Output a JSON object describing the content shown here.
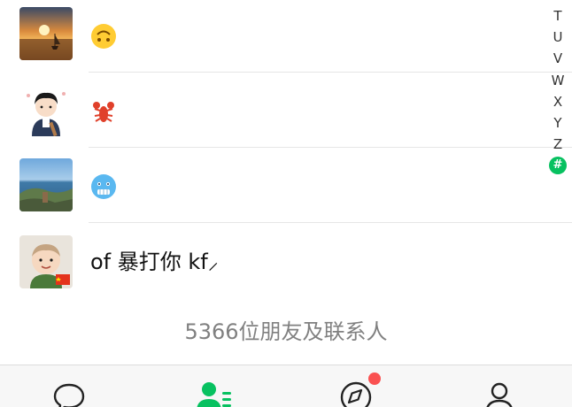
{
  "contacts": [
    {
      "name": "",
      "avatar": "sunset-sailboat-photo",
      "emoji": "upside-down-face"
    },
    {
      "name": "",
      "avatar": "cartoon-boy-avatar",
      "emoji": "lobster"
    },
    {
      "name": "",
      "avatar": "coastal-landscape-photo",
      "emoji": "cold-face"
    },
    {
      "name": "of 暴打你 kf⸝",
      "avatar": "baby-photo"
    }
  ],
  "index_bar": {
    "letters": [
      "T",
      "U",
      "V",
      "W",
      "X",
      "Y",
      "Z",
      "#"
    ],
    "active": "#"
  },
  "footer": {
    "count_text": "5366位朋友及联系人"
  },
  "tab_bar": {
    "tabs": [
      {
        "id": "chats",
        "icon": "chat-bubble-icon"
      },
      {
        "id": "contacts",
        "icon": "contacts-icon",
        "active": true
      },
      {
        "id": "discover",
        "icon": "compass-icon",
        "badge": true
      },
      {
        "id": "me",
        "icon": "person-icon"
      }
    ]
  },
  "colors": {
    "accent": "#07c160",
    "badge": "#fa5151",
    "secondary_text": "#808080"
  }
}
